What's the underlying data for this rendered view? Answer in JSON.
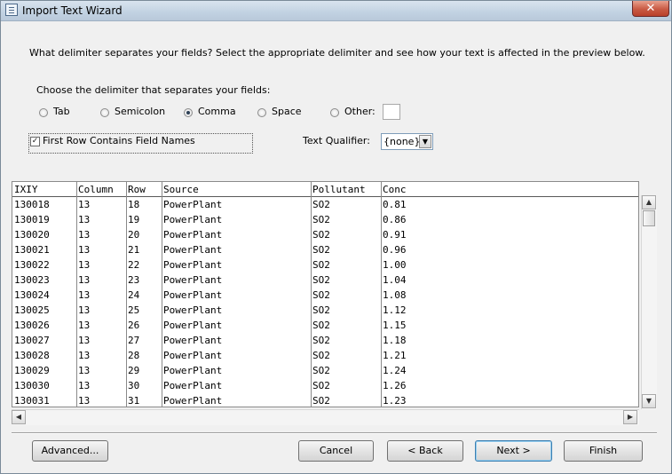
{
  "window": {
    "title": "Import Text Wizard",
    "close_label": "✕"
  },
  "prompt": "What delimiter separates your fields? Select the appropriate delimiter and see how your text is affected in the preview below.",
  "delimiter": {
    "label": "Choose the delimiter that separates your fields:",
    "options": [
      {
        "label": "Tab",
        "selected": false
      },
      {
        "label": "Semicolon",
        "selected": false
      },
      {
        "label": "Comma",
        "selected": true
      },
      {
        "label": "Space",
        "selected": false
      },
      {
        "label": "Other:",
        "selected": false
      }
    ],
    "other_value": ""
  },
  "first_row": {
    "label": "First Row Contains Field Names",
    "checked": true,
    "check_glyph": "✓"
  },
  "qualifier": {
    "label": "Text Qualifier:",
    "value": "{none}",
    "arrow_glyph": "▼"
  },
  "table": {
    "columns": [
      "IXIY",
      "Column",
      "Row",
      "Source",
      "Pollutant",
      "Conc"
    ],
    "rows": [
      [
        "130018",
        "13",
        "18",
        "PowerPlant",
        "SO2",
        "0.81"
      ],
      [
        "130019",
        "13",
        "19",
        "PowerPlant",
        "SO2",
        "0.86"
      ],
      [
        "130020",
        "13",
        "20",
        "PowerPlant",
        "SO2",
        "0.91"
      ],
      [
        "130021",
        "13",
        "21",
        "PowerPlant",
        "SO2",
        "0.96"
      ],
      [
        "130022",
        "13",
        "22",
        "PowerPlant",
        "SO2",
        "1.00"
      ],
      [
        "130023",
        "13",
        "23",
        "PowerPlant",
        "SO2",
        "1.04"
      ],
      [
        "130024",
        "13",
        "24",
        "PowerPlant",
        "SO2",
        "1.08"
      ],
      [
        "130025",
        "13",
        "25",
        "PowerPlant",
        "SO2",
        "1.12"
      ],
      [
        "130026",
        "13",
        "26",
        "PowerPlant",
        "SO2",
        "1.15"
      ],
      [
        "130027",
        "13",
        "27",
        "PowerPlant",
        "SO2",
        "1.18"
      ],
      [
        "130028",
        "13",
        "28",
        "PowerPlant",
        "SO2",
        "1.21"
      ],
      [
        "130029",
        "13",
        "29",
        "PowerPlant",
        "SO2",
        "1.24"
      ],
      [
        "130030",
        "13",
        "30",
        "PowerPlant",
        "SO2",
        "1.26"
      ],
      [
        "130031",
        "13",
        "31",
        "PowerPlant",
        "SO2",
        "1.23"
      ]
    ]
  },
  "scroll_icons": {
    "up": "▲",
    "down": "▼",
    "left": "◀",
    "right": "▶"
  },
  "buttons": {
    "advanced": "Advanced...",
    "cancel": "Cancel",
    "back": "< Back",
    "next": "Next >",
    "finish": "Finish"
  }
}
